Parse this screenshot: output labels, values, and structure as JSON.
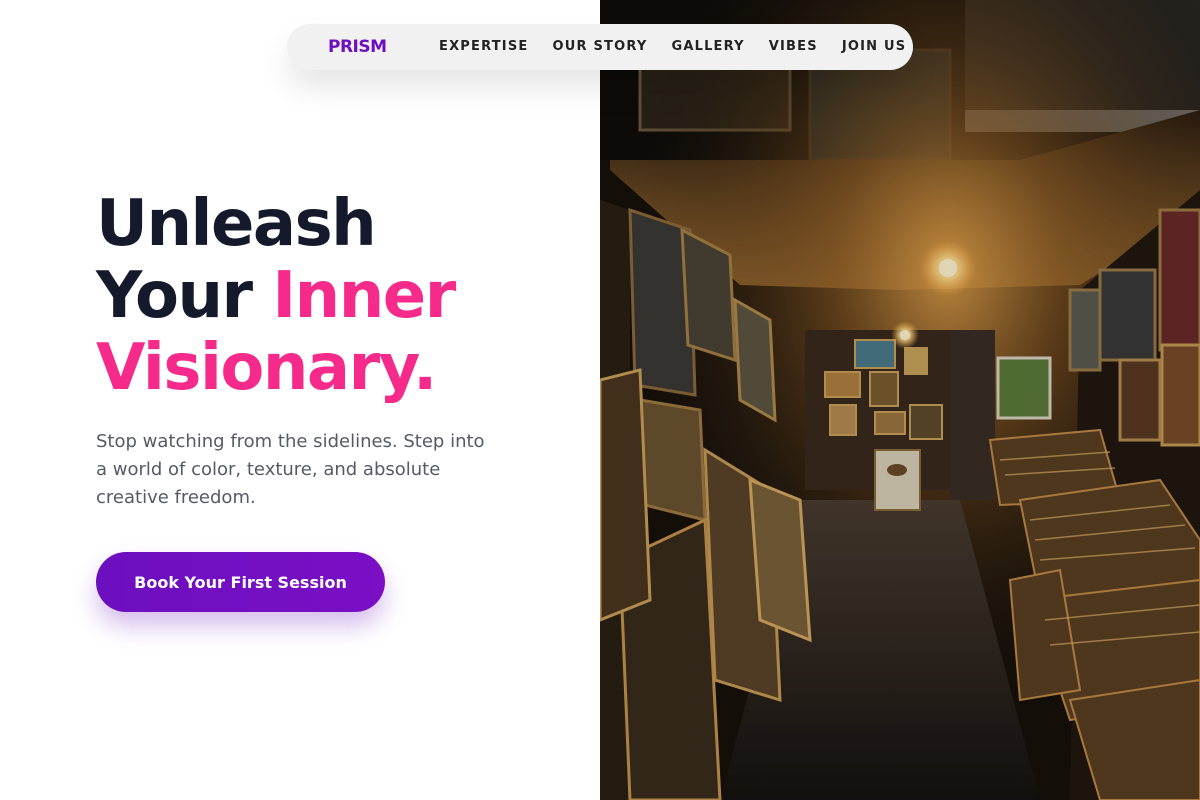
{
  "brand": {
    "logo_text": "PRISM",
    "logo_color": "#6e0fc0"
  },
  "nav": {
    "links": [
      {
        "label": "EXPERTISE"
      },
      {
        "label": "OUR STORY"
      },
      {
        "label": "GALLERY"
      },
      {
        "label": "VIBES"
      },
      {
        "label": "JOIN US"
      }
    ]
  },
  "hero": {
    "headline_line1": "Unleash",
    "headline_line2_plain": "Your",
    "headline_line2_accent": "Inner",
    "headline_line3_accent": "Visionary.",
    "subtext": "Stop watching from the sidelines. Step into a world of color, texture, and absolute creative freedom.",
    "cta_label": "Book Your First Session"
  },
  "colors": {
    "headline": "#141a2b",
    "accent_pink": "#f52a8a",
    "cta_purple": "#6c0fbf",
    "subtext": "#555a66"
  },
  "image": {
    "subject": "art-gallery-photo"
  }
}
